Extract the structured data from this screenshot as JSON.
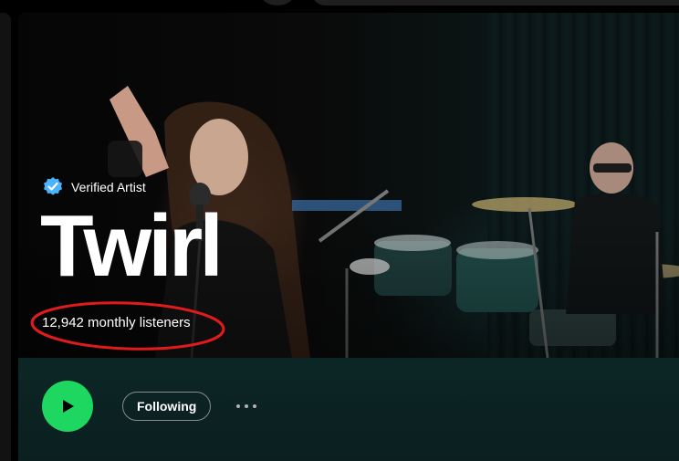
{
  "artist": {
    "verified_label": "Verified Artist",
    "name": "Twirl",
    "monthly_listeners": "12,942 monthly listeners"
  },
  "actions": {
    "follow_label": "Following"
  },
  "icons": {
    "verified": "verified-badge-icon",
    "play": "play-icon",
    "more": "more-options-icon"
  },
  "colors": {
    "accent_green": "#1ed760",
    "verified_blue": "#4cb3ff",
    "annotation_red": "#e01b1b",
    "action_bar_bg": "#0b1f1f"
  }
}
